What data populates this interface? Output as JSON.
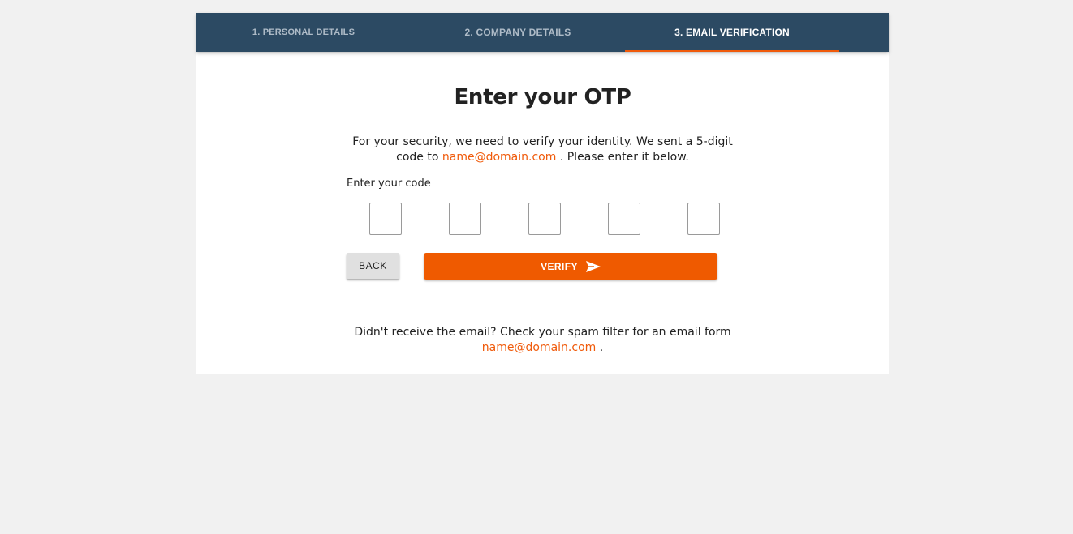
{
  "stepper": {
    "steps": [
      {
        "label": "1. PERSONAL DETAILS"
      },
      {
        "label": "2. COMPANY DETAILS"
      },
      {
        "label": "3. EMAIL VERIFICATION"
      }
    ],
    "active_step": 3
  },
  "otp": {
    "title": "Enter your OTP",
    "description_before": "For your security, we need to verify your identity. We sent a 5-digit code to",
    "email": "name@domain.com",
    "description_after": ". Please enter it below.",
    "code_label": "Enter your code",
    "code_values": [
      "",
      "",
      "",
      "",
      ""
    ]
  },
  "actions": {
    "back_label": "BACK",
    "verify_label": "VERIFY",
    "verify_icon": "send-icon"
  },
  "footer": {
    "note_before": "Didn't receive the email? Check your spam filter for an email form",
    "email": "name@domain.com",
    "note_after": "."
  },
  "colors": {
    "stepper_bg": "#2c4a63",
    "accent": "#f05a0a",
    "page_bg": "#f1f1f1"
  }
}
